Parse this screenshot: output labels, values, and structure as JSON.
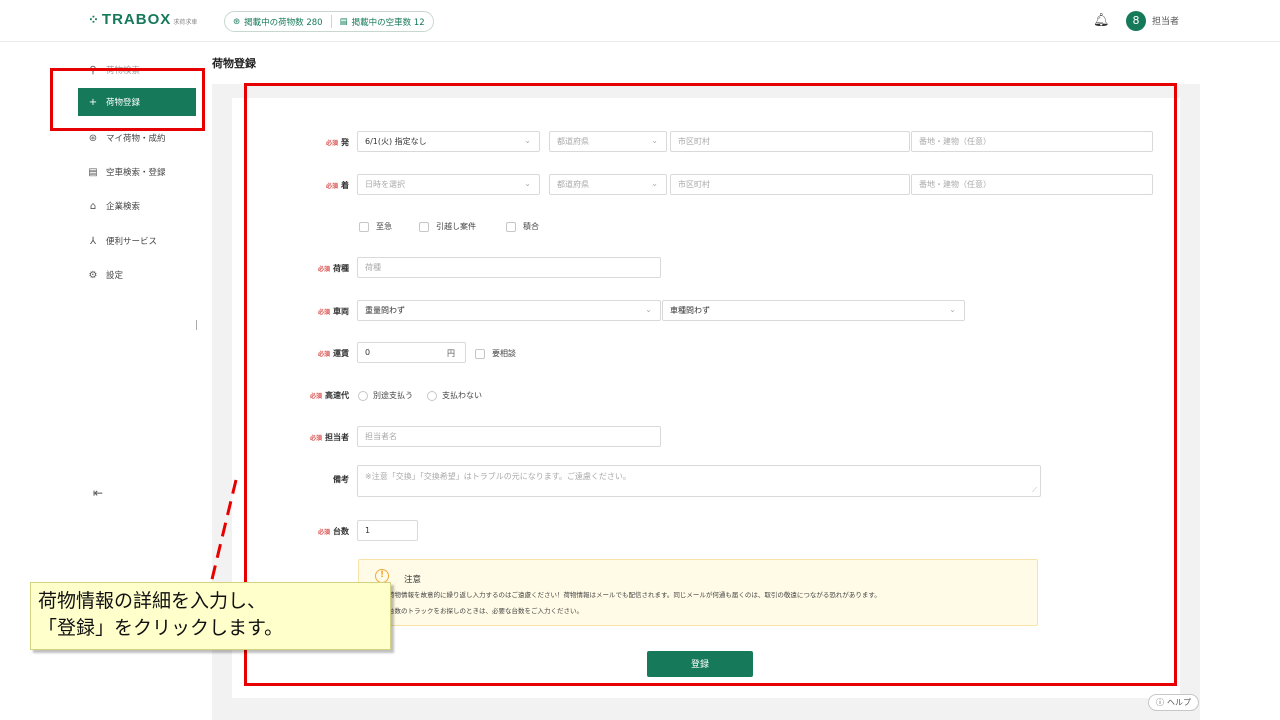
{
  "header": {
    "logo_text": "TRABOX",
    "logo_sub": "求荷求車",
    "cargo_stat": "掲載中の荷物数 280",
    "truck_stat": "掲載中の空車数 12",
    "user_name": "担当者",
    "avatar_glyph": "8"
  },
  "sidebar": {
    "items": [
      {
        "label": "荷物検索",
        "icon": "search-icon"
      },
      {
        "label": "荷物登録",
        "icon": "plus-icon",
        "active": true
      },
      {
        "label": "マイ荷物・成約",
        "icon": "box-icon"
      },
      {
        "label": "空車検索・登録",
        "icon": "truck-icon"
      },
      {
        "label": "企業検索",
        "icon": "home-icon"
      },
      {
        "label": "便利サービス",
        "icon": "network-icon"
      },
      {
        "label": "設定",
        "icon": "gear-icon"
      }
    ]
  },
  "page": {
    "title": "荷物登録"
  },
  "form": {
    "required_tag": "必須",
    "departure": {
      "label": "発",
      "date": "6/1(火) 指定なし",
      "prefecture_placeholder": "都道府県",
      "city_placeholder": "市区町村",
      "address_placeholder": "番地・建物（任意）"
    },
    "arrival": {
      "label": "着",
      "date_placeholder": "日時を選択",
      "prefecture_placeholder": "都道府県",
      "city_placeholder": "市区町村",
      "address_placeholder": "番地・建物（任意）"
    },
    "flags": [
      "至急",
      "引越し案件",
      "積合"
    ],
    "cargo_type": {
      "label": "荷種",
      "placeholder": "荷種"
    },
    "vehicle": {
      "label": "車両",
      "weight": "重量問わず",
      "type": "車種問わず"
    },
    "fare": {
      "label": "運賃",
      "value": "0",
      "unit": "円",
      "negotiable": "要相談"
    },
    "highway": {
      "label": "高速代",
      "options": [
        "別途支払う",
        "支払わない"
      ]
    },
    "contact": {
      "label": "担当者",
      "placeholder": "担当者名"
    },
    "remarks": {
      "label": "備考",
      "placeholder": "※注意「交換」「交換希望」はトラブルの元になります。ご遠慮ください。"
    },
    "count": {
      "label": "台数",
      "value": "1"
    },
    "notice": {
      "title": "注意",
      "line1": "同じ荷物情報を故意的に繰り返し入力するのはご遠慮ください！荷物情報はメールでも配信されます。同じメールが何通も届くのは、取引の敬遠につながる恐れがあります。",
      "line2": "複数台数のトラックをお探しのときは、必要な台数をご入力ください。"
    },
    "submit_label": "登録"
  },
  "help_label": "ヘルプ",
  "callout": {
    "line1": "荷物情報の詳細を入力し、",
    "line2": "「登録」をクリックします。"
  },
  "colors": {
    "brand": "#167a5a",
    "highlight": "#e60000",
    "callout_bg": "#ffffcc"
  }
}
